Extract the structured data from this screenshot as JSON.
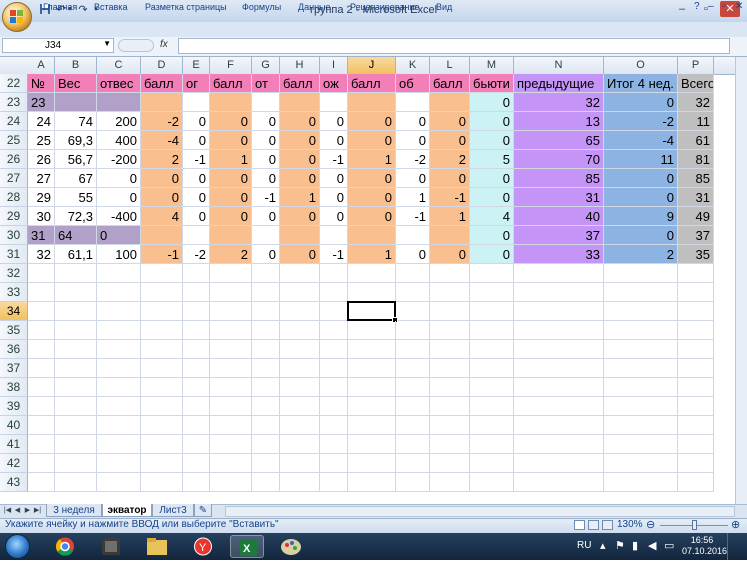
{
  "window": {
    "title": "группа 2 - Microsoft Excel",
    "min": "–",
    "max": "▫",
    "close": "✕"
  },
  "ribbon": {
    "tabs": [
      "Главная",
      "Вставка",
      "Разметка страницы",
      "Формулы",
      "Данные",
      "Рецензирование",
      "Вид"
    ],
    "help": "?"
  },
  "formula_bar": {
    "name_box": "J34",
    "fx": "fx",
    "value": ""
  },
  "columns": [
    {
      "name": "A"
    },
    {
      "name": "B"
    },
    {
      "name": "C"
    },
    {
      "name": "D"
    },
    {
      "name": "E"
    },
    {
      "name": "F"
    },
    {
      "name": "G"
    },
    {
      "name": "H"
    },
    {
      "name": "I"
    },
    {
      "name": "J",
      "selected": true
    },
    {
      "name": "K"
    },
    {
      "name": "L"
    },
    {
      "name": "M"
    },
    {
      "name": "N"
    },
    {
      "name": "O"
    },
    {
      "name": "P"
    }
  ],
  "header_row": {
    "row": "22",
    "cells": [
      "№",
      "Вес",
      "отвес",
      "балл",
      "ог",
      "балл",
      "от",
      "балл",
      "ож",
      "балл",
      "об",
      "балл",
      "бьюти",
      "предыдущие",
      "Итог 4 нед.",
      "Всего"
    ]
  },
  "data_rows": [
    {
      "row": "23",
      "cells": [
        "23",
        "",
        "",
        "",
        "",
        "",
        "",
        "",
        "",
        "",
        "",
        "",
        "0",
        "32",
        "0",
        "32"
      ]
    },
    {
      "row": "24",
      "cells": [
        "24",
        "74",
        "200",
        "-2",
        "0",
        "0",
        "0",
        "0",
        "0",
        "0",
        "0",
        "0",
        "0",
        "13",
        "-2",
        "11"
      ]
    },
    {
      "row": "25",
      "cells": [
        "25",
        "69,3",
        "400",
        "-4",
        "0",
        "0",
        "0",
        "0",
        "0",
        "0",
        "0",
        "0",
        "0",
        "65",
        "-4",
        "61"
      ]
    },
    {
      "row": "26",
      "cells": [
        "26",
        "56,7",
        "-200",
        "2",
        "-1",
        "1",
        "0",
        "0",
        "-1",
        "1",
        "-2",
        "2",
        "5",
        "70",
        "11",
        "81"
      ]
    },
    {
      "row": "27",
      "cells": [
        "27",
        "67",
        "0",
        "0",
        "0",
        "0",
        "0",
        "0",
        "0",
        "0",
        "0",
        "0",
        "0",
        "85",
        "0",
        "85"
      ]
    },
    {
      "row": "28",
      "cells": [
        "29",
        "55",
        "0",
        "0",
        "0",
        "0",
        "-1",
        "1",
        "0",
        "0",
        "1",
        "-1",
        "0",
        "31",
        "0",
        "31"
      ]
    },
    {
      "row": "29",
      "cells": [
        "30",
        "72,3",
        "-400",
        "4",
        "0",
        "0",
        "0",
        "0",
        "0",
        "0",
        "-1",
        "1",
        "4",
        "40",
        "9",
        "49"
      ]
    },
    {
      "row": "30",
      "cells": [
        "31",
        "64",
        "0",
        "",
        "",
        "",
        "",
        "",
        "",
        "",
        "",
        "",
        "0",
        "37",
        "0",
        "37"
      ]
    },
    {
      "row": "31",
      "cells": [
        "32",
        "61,1",
        "100",
        "-1",
        "-2",
        "2",
        "0",
        "0",
        "-1",
        "1",
        "0",
        "0",
        "0",
        "33",
        "2",
        "35"
      ]
    }
  ],
  "empty_rows": [
    "32",
    "33",
    "34",
    "35",
    "36",
    "37",
    "38",
    "39",
    "40",
    "41",
    "42",
    "43"
  ],
  "selected_row": "34",
  "colors": {
    "header_pink": "#f27fb8",
    "lavender": "#b1a0c7",
    "orange": "#fabf8f",
    "aqua": "#ccf2f5",
    "purple": "#c594f7",
    "blue": "#8db3e2",
    "gray": "#bfbfbf"
  },
  "sheets": [
    {
      "label": "3 неделя",
      "active": false
    },
    {
      "label": "экватор",
      "active": true
    },
    {
      "label": "Лист3",
      "active": false
    }
  ],
  "status": {
    "text": "Укажите ячейку и нажмите ВВОД или выберите \"Вставить\"",
    "zoom": "130%"
  },
  "taskbar": {
    "lang": "RU",
    "time": "16:56",
    "date": "07.10.2016"
  }
}
